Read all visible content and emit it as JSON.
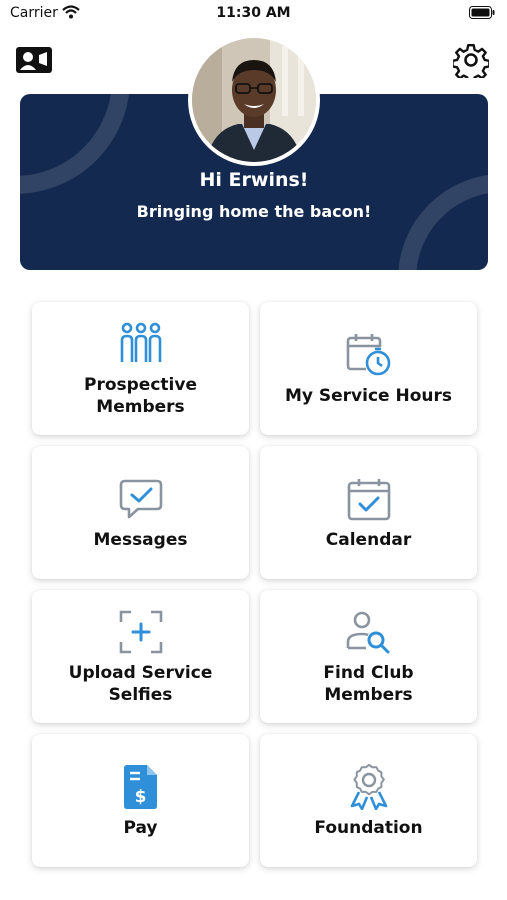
{
  "status_bar": {
    "carrier": "Carrier",
    "time": "11:30 AM"
  },
  "header": {
    "greeting": "Hi Erwins!",
    "tagline": "Bringing home the bacon!",
    "left_icon": "contact-card-icon",
    "right_icon": "gear-icon"
  },
  "colors": {
    "banner": "#14294f",
    "icon_gray": "#8a94a0",
    "icon_blue": "#2f8fd8"
  },
  "tiles": [
    {
      "label": "Prospective\nMembers",
      "icon": "people-icon"
    },
    {
      "label": "My Service Hours",
      "icon": "clock-calendar-icon"
    },
    {
      "label": "Messages",
      "icon": "message-check-icon"
    },
    {
      "label": "Calendar",
      "icon": "calendar-check-icon"
    },
    {
      "label": "Upload Service\nSelfies",
      "icon": "upload-frame-icon"
    },
    {
      "label": "Find Club\nMembers",
      "icon": "person-search-icon"
    },
    {
      "label": "Pay",
      "icon": "bill-dollar-icon"
    },
    {
      "label": "Foundation",
      "icon": "award-ribbon-icon"
    }
  ]
}
